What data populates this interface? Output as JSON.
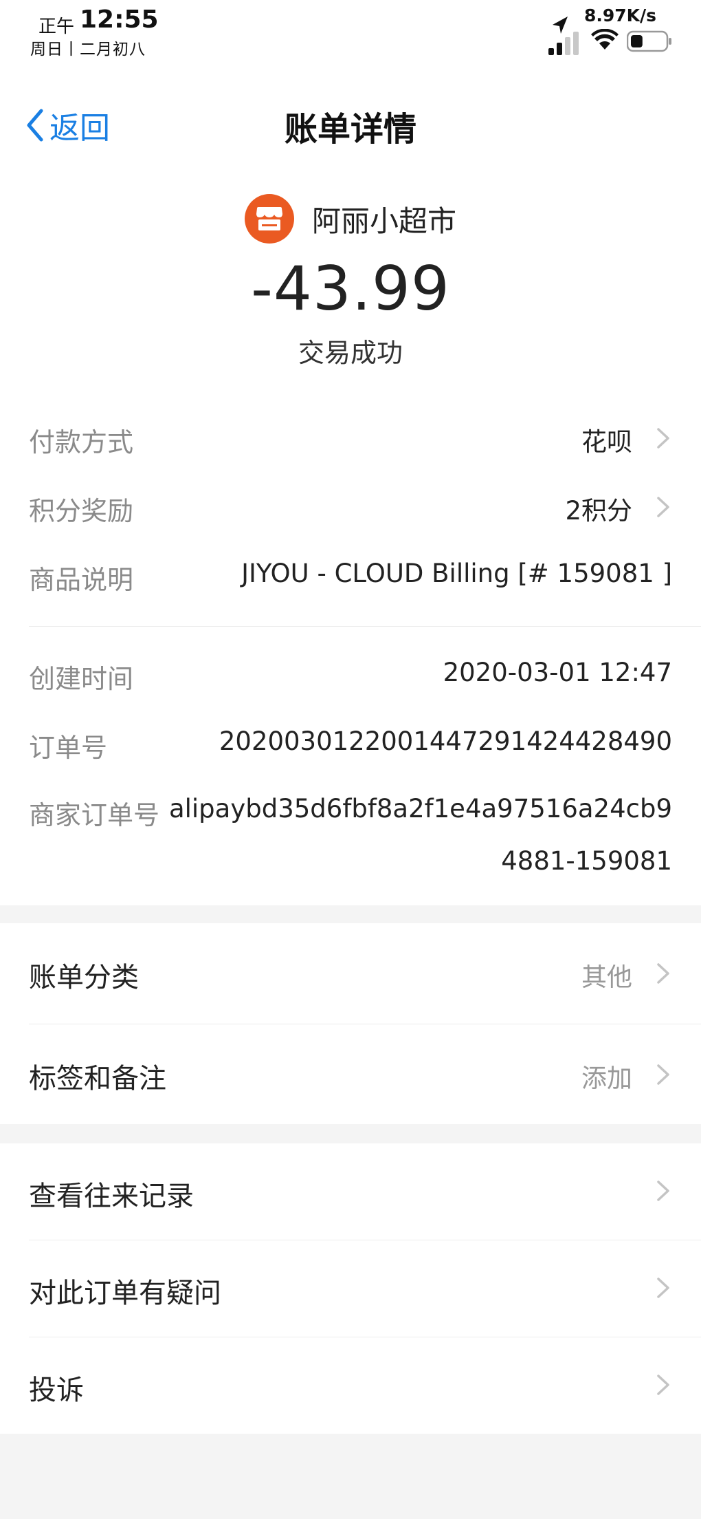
{
  "status_bar": {
    "time_prefix": "正午",
    "time": "12:55",
    "date": "周日丨二月初八",
    "net_speed": "8.97K/s",
    "icons": [
      "location-arrow-icon",
      "signal-icon",
      "wifi-icon",
      "battery-icon"
    ],
    "battery_level": 0.35
  },
  "nav": {
    "back_label": "返回",
    "title": "账单详情"
  },
  "merchant": {
    "name": "阿丽小超市",
    "icon": "store-icon",
    "logo_color": "#ea5a22"
  },
  "amount": "-43.99",
  "status": "交易成功",
  "details": [
    {
      "label": "付款方式",
      "value": "花呗"
    },
    {
      "label": "积分奖励",
      "value": "2积分"
    },
    {
      "label": "商品说明",
      "value": "JIYOU - CLOUD Billing [# 159081 ]"
    },
    {
      "label": "创建时间",
      "value": "2020-03-01 12:47"
    },
    {
      "label": "订单号",
      "value": "2020030122001447291424428490"
    },
    {
      "label": "商家订单号",
      "value_line1": "alipaybd35d6fbf8a2f1e4a97516a24cb9",
      "value_line2": "4881-159081"
    }
  ],
  "group2": [
    {
      "label": "账单分类",
      "value": "其他"
    },
    {
      "label": "标签和备注",
      "value": "添加"
    }
  ],
  "group3": [
    {
      "label": "查看往来记录"
    },
    {
      "label": "对此订单有疑问"
    },
    {
      "label": "投诉"
    }
  ],
  "colors": {
    "accent": "#1a7fe3",
    "label_gray": "#8a8a8a",
    "background": "#f4f4f4"
  }
}
